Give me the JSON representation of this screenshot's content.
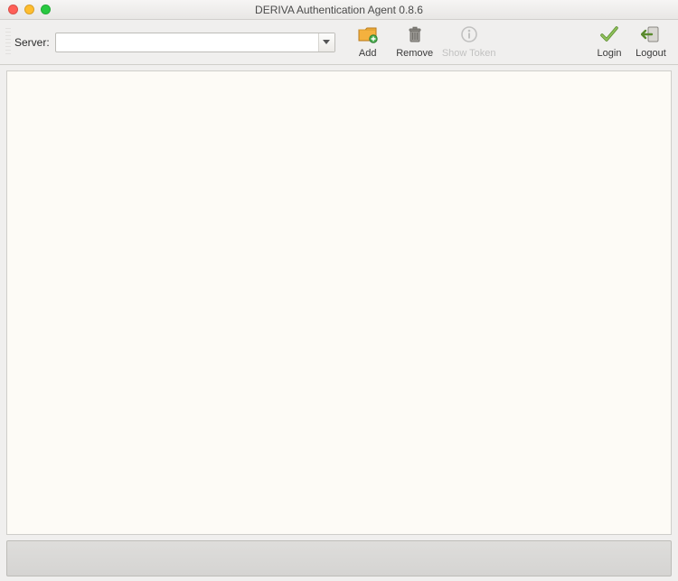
{
  "window": {
    "title": "DERIVA Authentication Agent 0.8.6"
  },
  "toolbar": {
    "server_label": "Server:",
    "server_value": "",
    "buttons": {
      "add": "Add",
      "remove": "Remove",
      "show_token": "Show Token",
      "login": "Login",
      "logout": "Logout"
    }
  },
  "content": {
    "body": ""
  },
  "status": {
    "text": ""
  }
}
